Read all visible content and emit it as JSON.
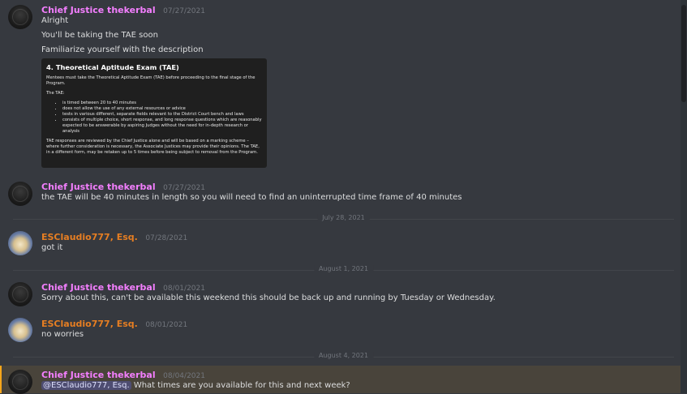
{
  "colors": {
    "background": "#36393f",
    "chief_name": "#f47fff",
    "claudio_name": "#e67e22",
    "timestamp": "#72767d",
    "mention_highlight": "#faa61a"
  },
  "messages": [
    {
      "author": "Chief Justice thekerbal",
      "timestamp": "07/27/2021",
      "lines": [
        "Alright",
        "You'll be taking the TAE soon",
        "Familiarize yourself with the description"
      ],
      "embed": {
        "title": "4. Theoretical Aptitude Exam (TAE)",
        "intro": "Mentees must take the Theoretical Aptitude Exam (TAE) before proceeding to the final stage of the Program.",
        "list_title": "The TAE:",
        "bullets": [
          "is timed between 20 to 40 minutes",
          "does not allow the use of any external resources or advice",
          "tests in various different, separate fields relevant to the District Court bench and laws",
          "consists of multiple choice, short response, and long response questions which are reasonably expected to be answerable by aspiring Judges without the need for in-depth research or analysis"
        ],
        "footer": "TAE responses are reviewed by the Chief Justice alone and will be based on a marking scheme – where further consideration is necessary, the Associate Justices may provide their opinions. The TAE, in a different form, may be retaken up to 5 times before being subject to removal from the Program."
      }
    },
    {
      "author": "Chief Justice thekerbal",
      "timestamp": "07/27/2021",
      "lines": [
        "the TAE will be 40 minutes in length so you will need to find an uninterrupted time frame of 40 minutes"
      ]
    },
    {
      "author": "ESClaudio777, Esq.",
      "timestamp": "07/28/2021",
      "lines": [
        "got it"
      ]
    },
    {
      "author": "Chief Justice thekerbal",
      "timestamp": "08/01/2021",
      "lines": [
        "Sorry about this, can't be available this weekend this should be back up and running by Tuesday or Wednesday."
      ]
    },
    {
      "author": "ESClaudio777, Esq.",
      "timestamp": "08/01/2021",
      "lines": [
        "no worries"
      ]
    },
    {
      "author": "Chief Justice thekerbal",
      "timestamp": "08/04/2021",
      "mention": "@ESClaudio777, Esq.",
      "lines": [
        " What times are you available for this and next week?"
      ]
    }
  ],
  "dividers": [
    "July 28, 2021",
    "August 1, 2021",
    "August 4, 2021"
  ]
}
